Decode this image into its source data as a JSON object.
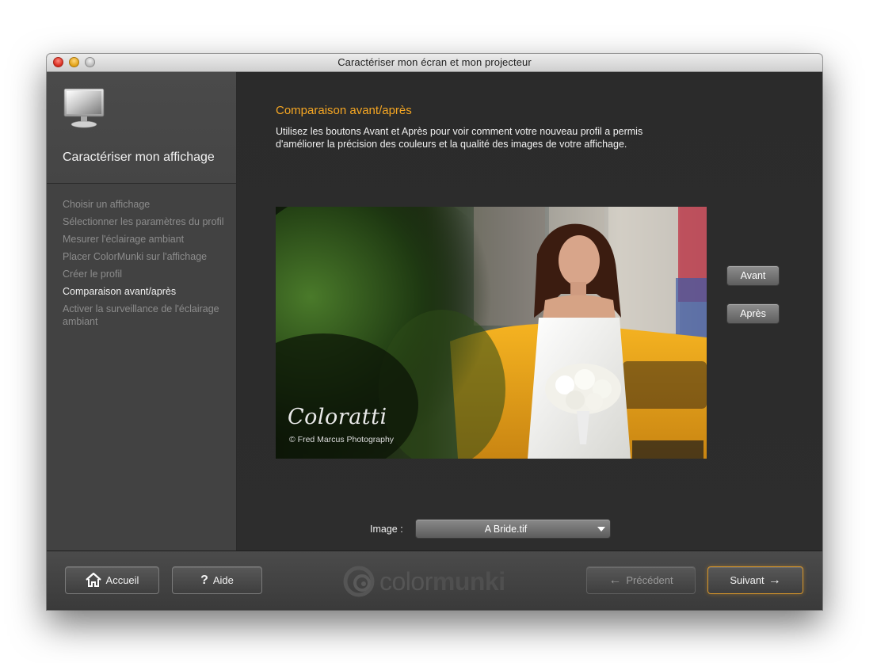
{
  "window": {
    "title": "Caractériser mon écran et mon projecteur"
  },
  "sidebar": {
    "title": "Caractériser mon affichage",
    "header_icon": "monitor-icon",
    "steps": [
      {
        "label": "Choisir un affichage",
        "active": false
      },
      {
        "label": "Sélectionner les paramètres du profil",
        "active": false
      },
      {
        "label": "Mesurer l'éclairage ambiant",
        "active": false
      },
      {
        "label": "Placer ColorMunki sur l'affichage",
        "active": false
      },
      {
        "label": "Créer le profil",
        "active": false
      },
      {
        "label": "Comparaison avant/après",
        "active": true
      },
      {
        "label": "Activer la surveillance de l'éclairage ambiant",
        "active": false
      }
    ]
  },
  "main": {
    "section_title": "Comparaison avant/après",
    "description": "Utilisez les boutons Avant et Après pour voir comment votre nouveau profil a permis d'améliorer la précision des couleurs et la qualité des images de votre affichage.",
    "photo": {
      "watermark_brand": "Coloratti",
      "watermark_credit": "© Fred Marcus Photography"
    },
    "buttons": {
      "before": "Avant",
      "after": "Après"
    },
    "image_label": "Image :",
    "image_select_value": "A Bride.tif"
  },
  "footer": {
    "home": "Accueil",
    "help": "Aide",
    "help_glyph": "?",
    "previous": "Précédent",
    "previous_glyph": "←",
    "next": "Suivant",
    "next_glyph": "→",
    "brand_light": "color",
    "brand_bold": "munki"
  },
  "colors": {
    "accent": "#f5a623",
    "sidebar_bg": "#424242",
    "main_bg": "#2b2b2b"
  }
}
